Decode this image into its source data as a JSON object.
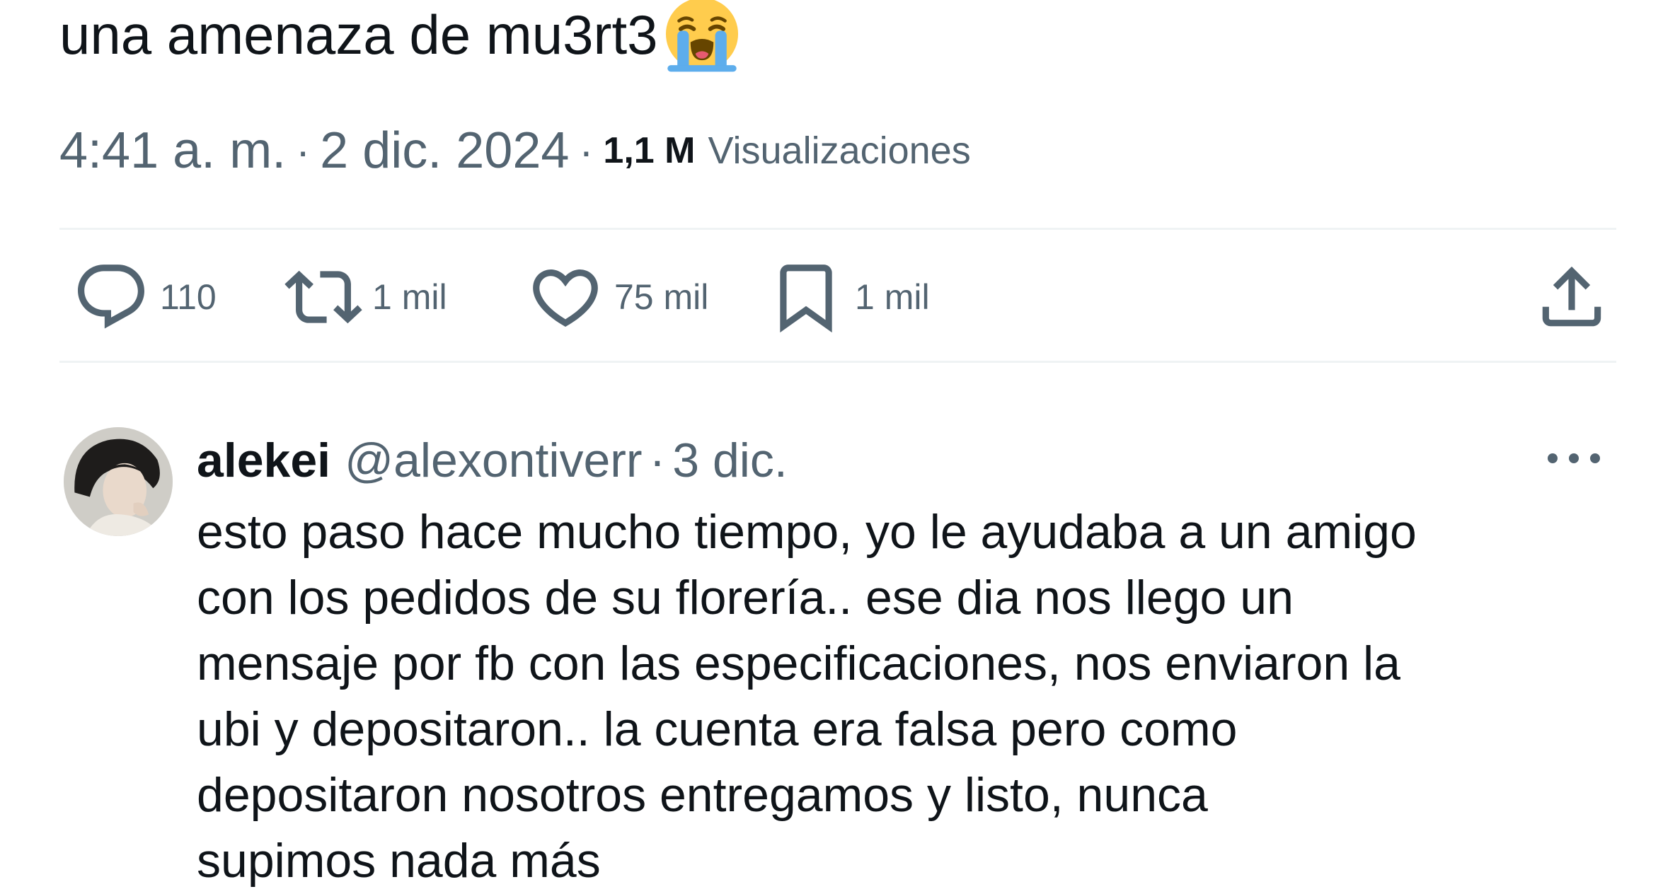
{
  "tweet": {
    "text": "una amenaza de mu3rt3",
    "emoji_icon": "loudly-crying-face-emoji",
    "time": "4:41 a. m.",
    "date": "2 dic. 2024",
    "separator": "·",
    "views_count": "1,1 M",
    "views_label": "Visualizaciones"
  },
  "actions": {
    "replies": {
      "icon": "reply-bubble-icon",
      "count": "110"
    },
    "reposts": {
      "icon": "retweet-icon",
      "count": "1 mil"
    },
    "likes": {
      "icon": "heart-icon",
      "count": "75 mil"
    },
    "bookmarks": {
      "icon": "bookmark-icon",
      "count": "1 mil"
    },
    "share": {
      "icon": "share-upload-icon"
    }
  },
  "reply": {
    "name": "alekei",
    "handle": "@alexontiverr",
    "separator": "·",
    "date": "3 dic.",
    "more_icon": "more-options-icon",
    "lines": [
      "esto paso hace mucho tiempo, yo le ayudaba a un amigo",
      "con los pedidos de su florería.. ese dia nos llego un",
      "mensaje por fb con las especificaciones, nos enviaron la",
      "ubi y depositaron.. la cuenta era falsa pero como",
      "depositaron nosotros entregamos y listo, nunca",
      "supimos nada más"
    ]
  },
  "colors": {
    "text_primary": "#0f1419",
    "text_secondary": "#536471",
    "divider": "#eff3f4",
    "background": "#ffffff"
  }
}
